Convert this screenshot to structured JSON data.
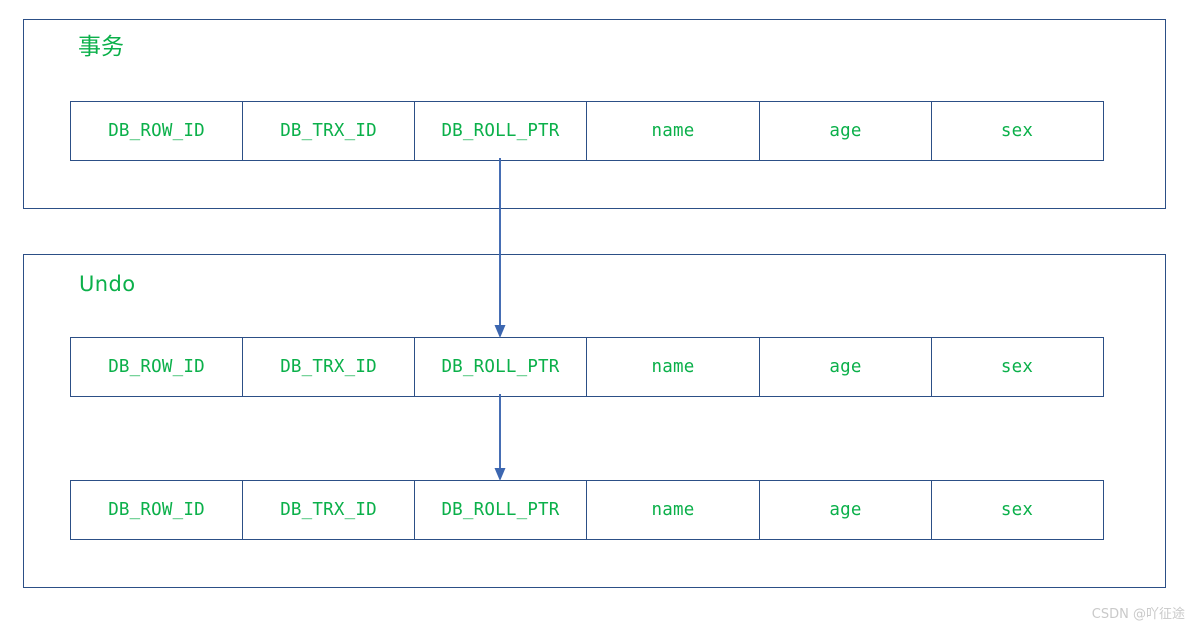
{
  "diagram": {
    "title_transaction": "事务",
    "title_undo": "Undo",
    "columns": [
      "DB_ROW_ID",
      "DB_TRX_ID",
      "DB_ROLL_PTR",
      "name",
      "age",
      "sex"
    ],
    "records": [
      {
        "id": "transaction-record",
        "group": "事务",
        "cells": [
          "DB_ROW_ID",
          "DB_TRX_ID",
          "DB_ROLL_PTR",
          "name",
          "age",
          "sex"
        ]
      },
      {
        "id": "undo-record-1",
        "group": "Undo",
        "cells": [
          "DB_ROW_ID",
          "DB_TRX_ID",
          "DB_ROLL_PTR",
          "name",
          "age",
          "sex"
        ]
      },
      {
        "id": "undo-record-2",
        "group": "Undo",
        "cells": [
          "DB_ROW_ID",
          "DB_TRX_ID",
          "DB_ROLL_PTR",
          "name",
          "age",
          "sex"
        ]
      }
    ],
    "connectors": [
      {
        "name": "roll-ptr-to-undo-1",
        "from": "transaction-record.DB_ROLL_PTR",
        "to": "undo-record-1.DB_ROLL_PTR"
      },
      {
        "name": "roll-ptr-to-undo-2",
        "from": "undo-record-1.DB_ROLL_PTR",
        "to": "undo-record-2.DB_ROLL_PTR"
      }
    ],
    "colors": {
      "border": "#2c4f86",
      "text": "#0bb04a",
      "arrow": "#3c66b0",
      "watermark": "#c9c9c9",
      "background": "#ffffff"
    }
  },
  "watermark": {
    "text": "CSDN @吖征途"
  }
}
